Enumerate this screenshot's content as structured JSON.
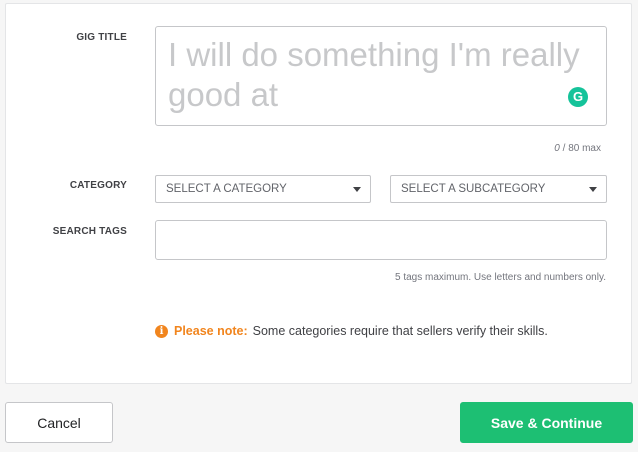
{
  "form": {
    "gig_title": {
      "label": "GIG TITLE",
      "placeholder": "I will do something I'm really good at",
      "value": "",
      "counter_current": "0",
      "counter_rest": " / 80 max",
      "grammarly_icon": "G"
    },
    "category": {
      "label": "CATEGORY",
      "category_select": "SELECT A CATEGORY",
      "subcategory_select": "SELECT A SUBCATEGORY"
    },
    "search_tags": {
      "label": "SEARCH TAGS",
      "value": "",
      "hint": "5 tags maximum. Use letters and numbers only."
    },
    "note": {
      "icon": "i",
      "strong": "Please note:",
      "text": "Some categories require that sellers verify their skills."
    }
  },
  "actions": {
    "cancel_label": "Cancel",
    "save_label": "Save & Continue"
  },
  "colors": {
    "primary": "#1dbf73",
    "warning": "#f1851e",
    "grammarly": "#15c39a"
  },
  "icons": {
    "grammarly": "grammarly-icon",
    "dropdown": "caret-down-icon",
    "note": "info-icon"
  }
}
